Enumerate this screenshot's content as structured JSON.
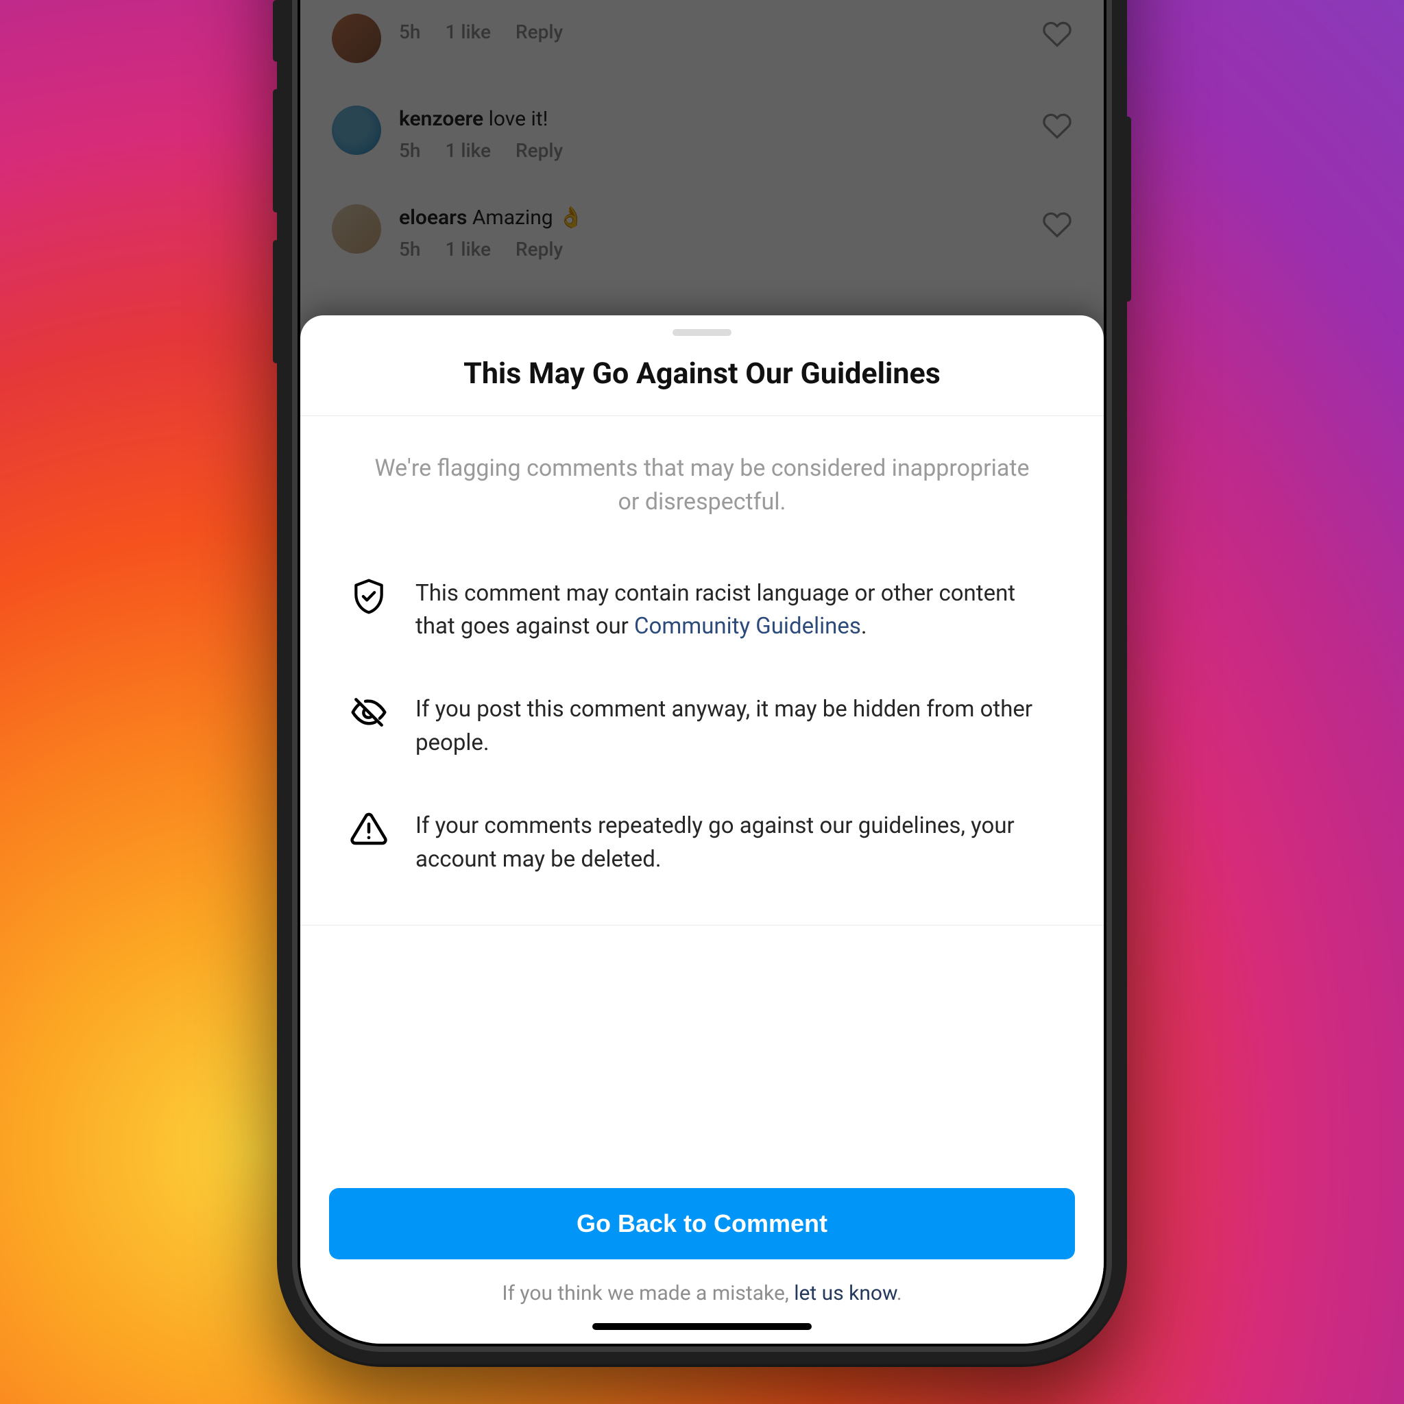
{
  "comments": [
    {
      "username": "",
      "text": "",
      "time": "5h",
      "likes": "1 like",
      "reply": "Reply"
    },
    {
      "username": "kenzoere",
      "text": "love it!",
      "time": "5h",
      "likes": "1 like",
      "reply": "Reply"
    },
    {
      "username": "eloears",
      "text": "Amazing 👌",
      "time": "5h",
      "likes": "1 like",
      "reply": "Reply"
    }
  ],
  "sheet": {
    "title": "This May Go Against Our Guidelines",
    "subtitle": "We're flagging comments that may be considered inappropriate or disrespectful.",
    "bullets": {
      "b1_pre": "This comment may contain racist language or other content that goes against our ",
      "b1_link": "Community Guidelines",
      "b1_post": ".",
      "b2": "If you post this comment anyway, it may be hidden from other people.",
      "b3": "If your comments repeatedly go against our guidelines, your account may be deleted."
    },
    "primary": "Go Back to Comment",
    "mistake_pre": "If you think we made a mistake, ",
    "mistake_link": "let us know",
    "mistake_post": "."
  }
}
